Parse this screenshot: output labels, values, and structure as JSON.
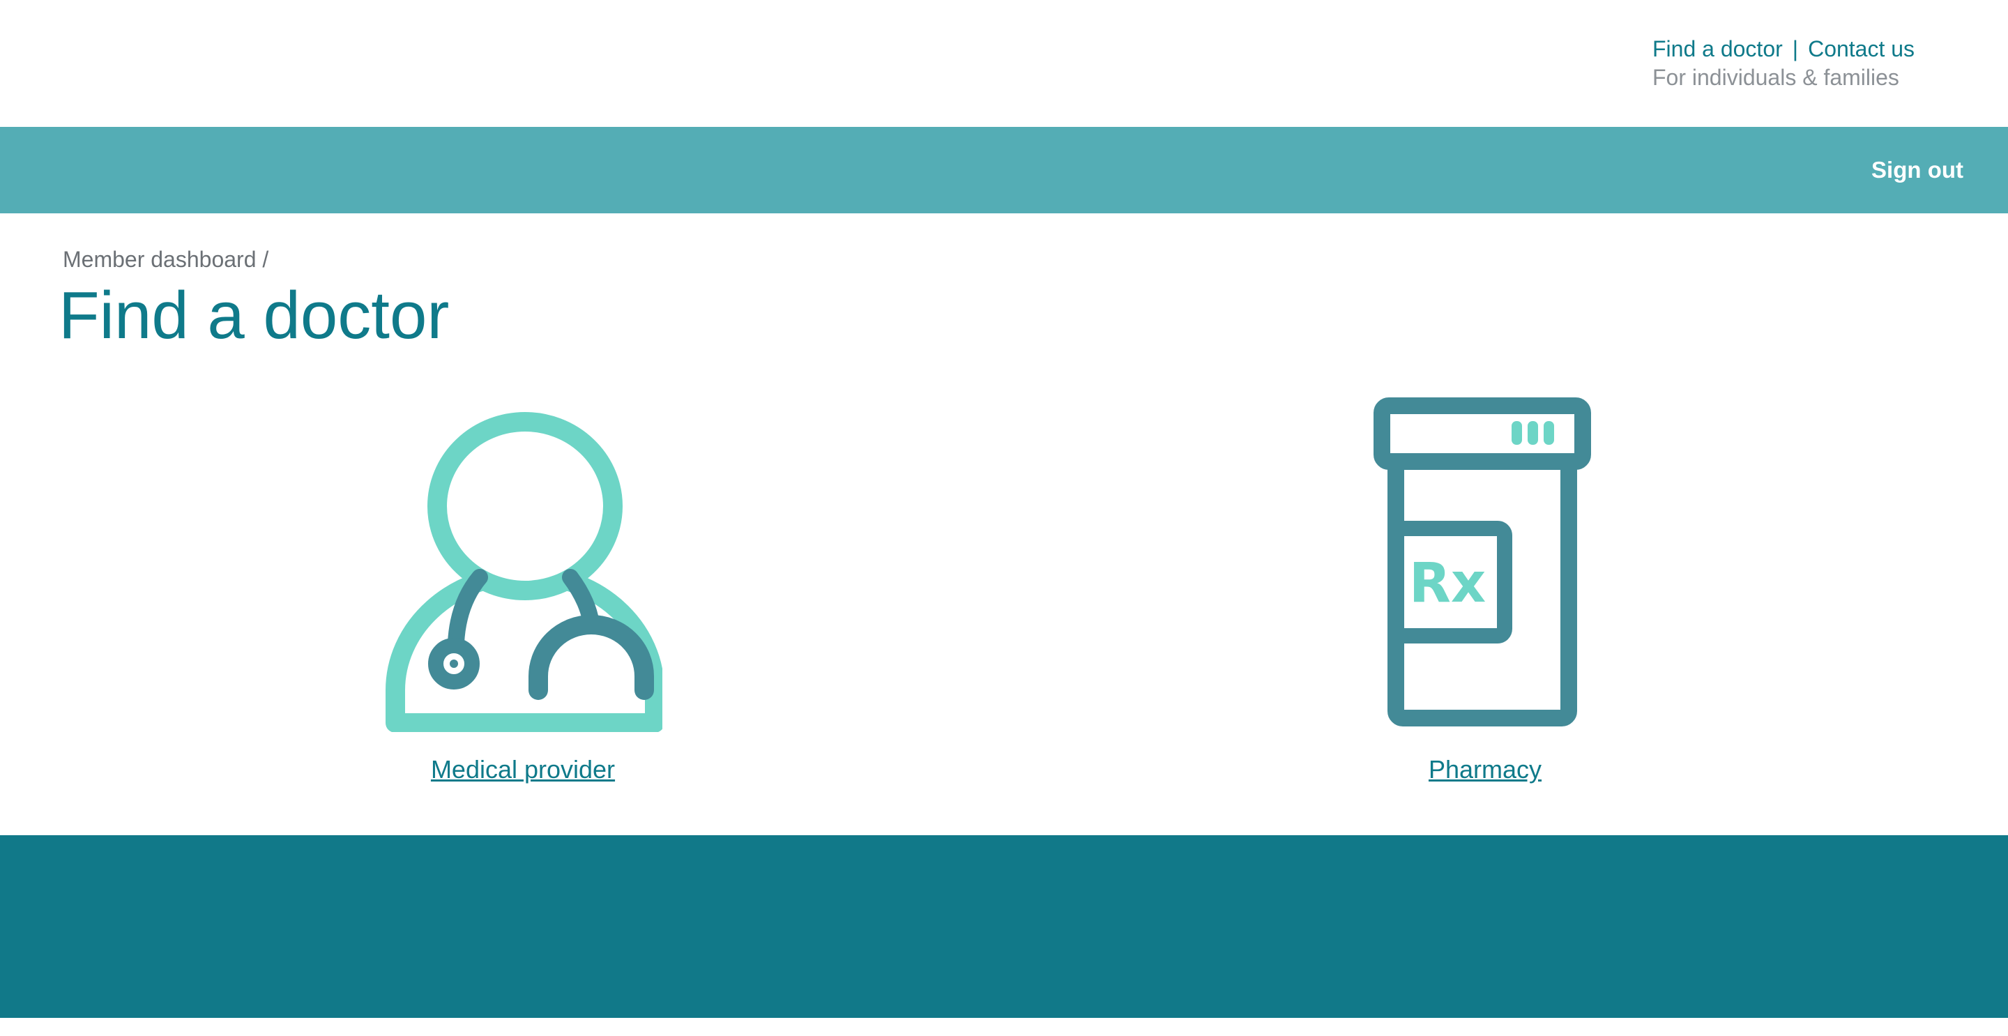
{
  "colors": {
    "brand_teal": "#0f7a8a",
    "nav_bar": "#54adb5",
    "footer": "#117989",
    "icon_mint": "#6dd5c6",
    "icon_slate": "#438a97",
    "muted_text": "#8c9196"
  },
  "header": {
    "find_doctor_link": "Find a doctor",
    "separator": "|",
    "contact_link": "Contact us",
    "tagline": "For individuals & families"
  },
  "nav": {
    "sign_out": "Sign out"
  },
  "breadcrumb": {
    "parent": "Member dashboard",
    "separator": "/"
  },
  "page": {
    "title": "Find a doctor"
  },
  "options": [
    {
      "label": "Medical provider",
      "icon": "doctor-icon"
    },
    {
      "label": "Pharmacy",
      "icon": "pill-bottle-icon"
    }
  ],
  "pill_label": "Rx"
}
